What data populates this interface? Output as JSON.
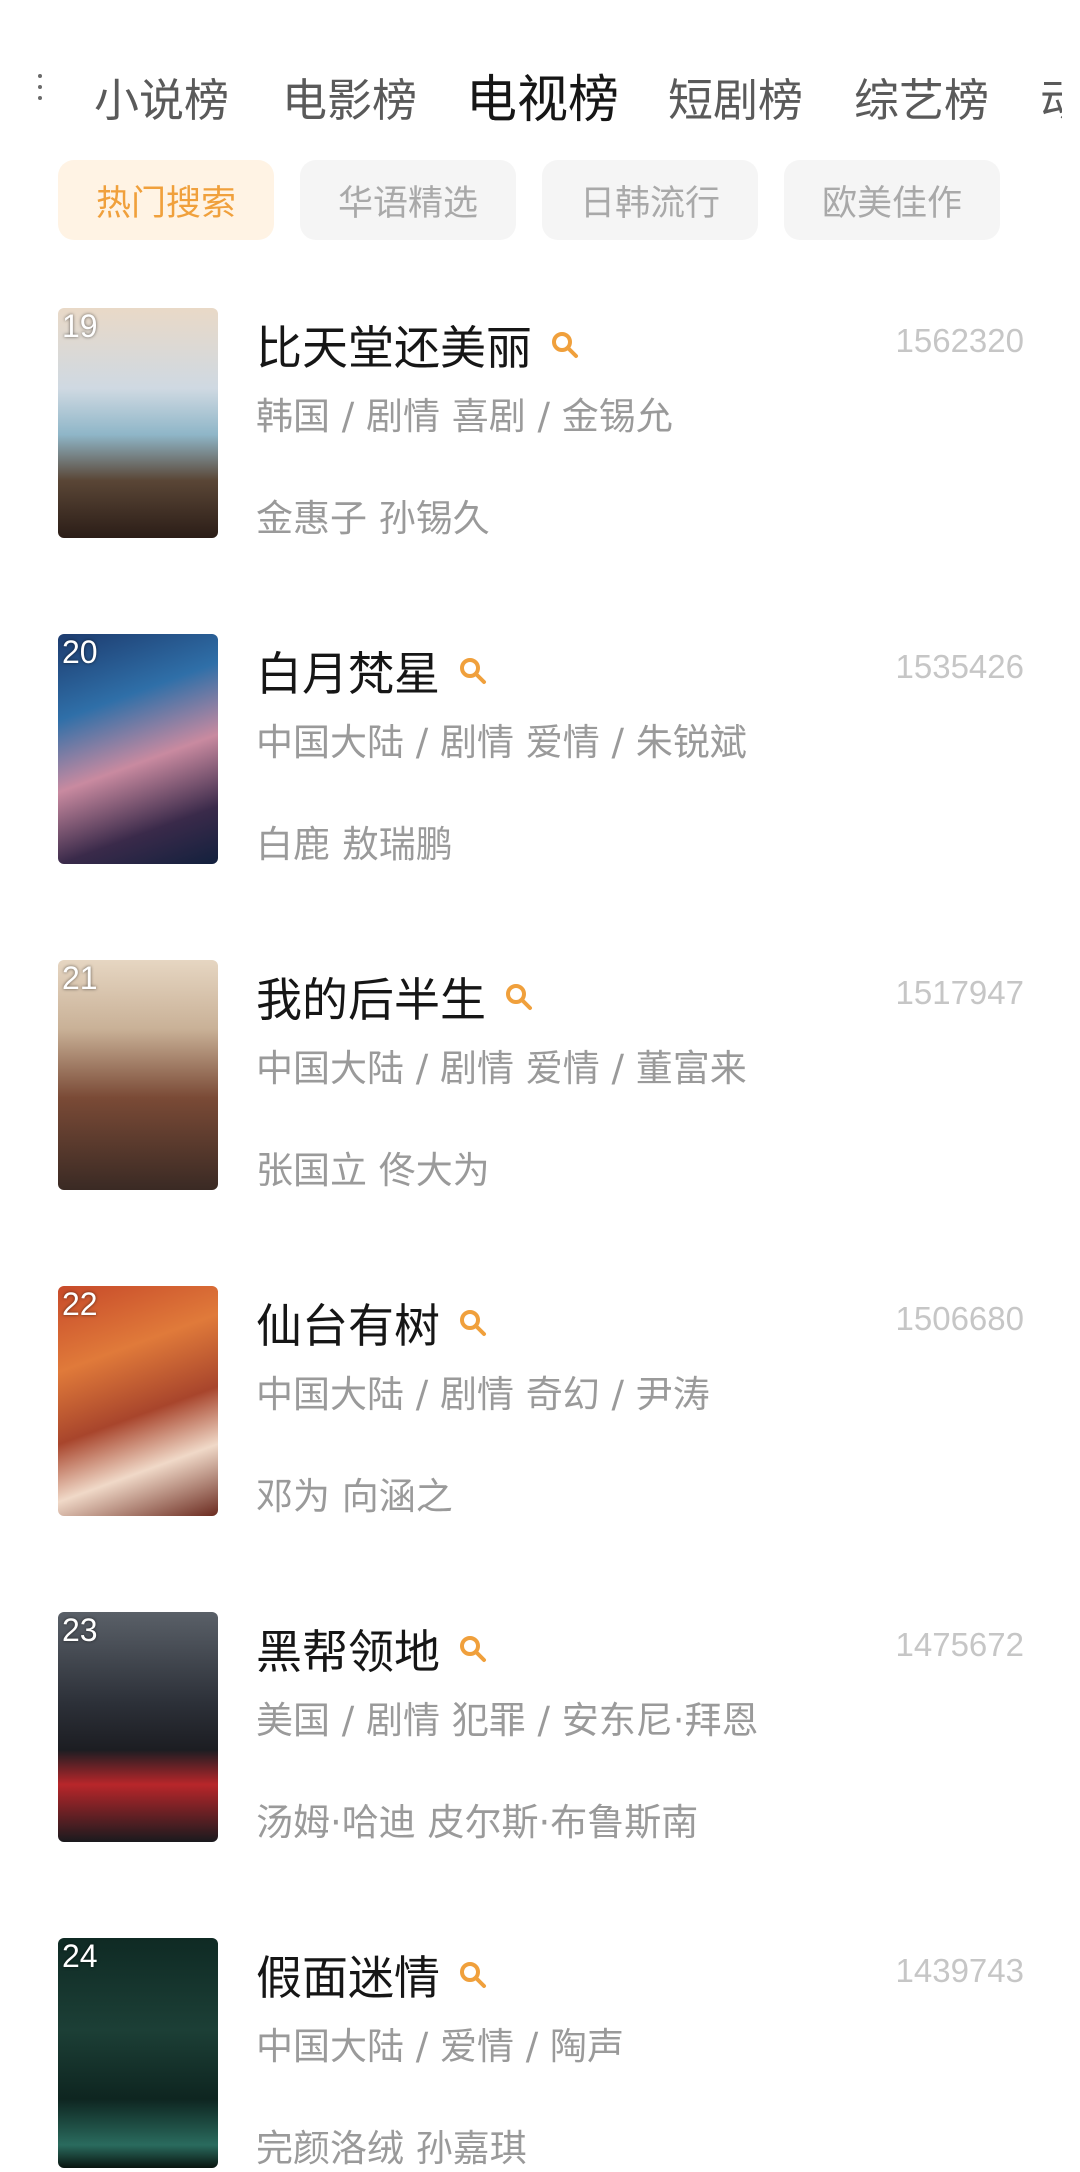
{
  "tabs": [
    "小说榜",
    "电影榜",
    "电视榜",
    "短剧榜",
    "综艺榜",
    "动漫榜"
  ],
  "active_tab": "电视榜",
  "chips": [
    "热门搜索",
    "华语精选",
    "日韩流行",
    "欧美佳作"
  ],
  "active_chip": "热门搜索",
  "colors": {
    "accent": "#f0a03c",
    "chip_active_bg": "#fff3e4"
  },
  "items": [
    {
      "rank": "19",
      "title": "比天堂还美丽",
      "score": "1562320",
      "meta": "韩国 / 剧情 喜剧 / 金锡允",
      "cast": "金惠子 孙锡久",
      "poster_icon": "poster-image"
    },
    {
      "rank": "20",
      "title": "白月梵星",
      "score": "1535426",
      "meta": "中国大陆 / 剧情 爱情 / 朱锐斌",
      "cast": "白鹿 敖瑞鹏",
      "poster_icon": "poster-image"
    },
    {
      "rank": "21",
      "title": "我的后半生",
      "score": "1517947",
      "meta": "中国大陆 / 剧情 爱情 / 董富来",
      "cast": "张国立 佟大为",
      "poster_icon": "poster-image"
    },
    {
      "rank": "22",
      "title": "仙台有树",
      "score": "1506680",
      "meta": "中国大陆 / 剧情 奇幻 / 尹涛",
      "cast": "邓为 向涵之",
      "poster_icon": "poster-image"
    },
    {
      "rank": "23",
      "title": "黑帮领地",
      "score": "1475672",
      "meta": "美国 / 剧情 犯罪 / 安东尼·拜恩",
      "cast": "汤姆·哈迪 皮尔斯·布鲁斯南",
      "poster_icon": "poster-image"
    },
    {
      "rank": "24",
      "title": "假面迷情",
      "score": "1439743",
      "meta": "中国大陆 / 爱情 / 陶声",
      "cast": "完颜洛绒 孙嘉琪",
      "poster_icon": "poster-image"
    }
  ]
}
